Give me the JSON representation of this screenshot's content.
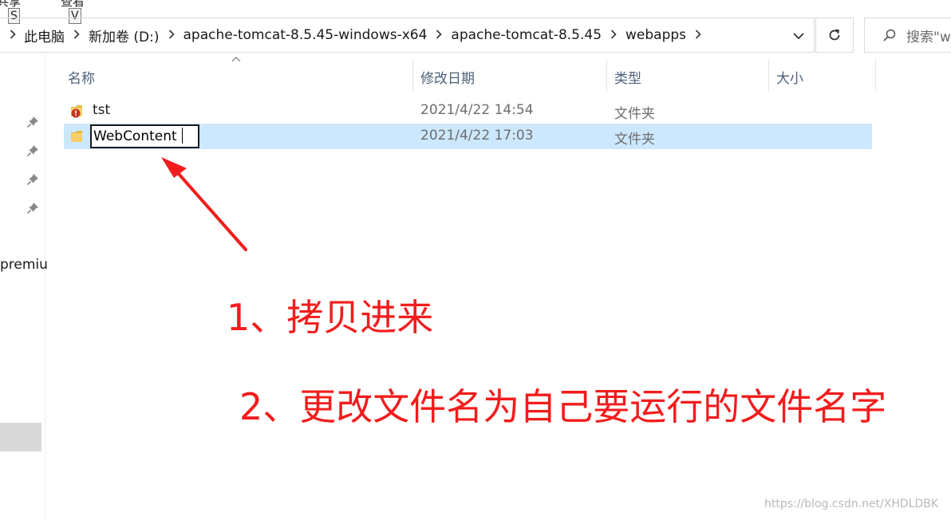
{
  "ribbon": {
    "tab1_label": "共享",
    "tab2_label": "查看",
    "keytip1": "S",
    "keytip2": "V"
  },
  "address_bar": {
    "breadcrumbs": [
      "此电脑",
      "新加卷 (D:)",
      "apache-tomcat-8.5.45-windows-x64",
      "apache-tomcat-8.5.45",
      "webapps"
    ]
  },
  "search": {
    "placeholder": "搜索\"w"
  },
  "nav_pane": {
    "partial_item": "premiu"
  },
  "columns": {
    "name": "名称",
    "date_modified": "修改日期",
    "type": "类型",
    "size": "大小"
  },
  "rows": [
    {
      "name": "tst",
      "date": "2021/4/22 14:54",
      "type": "文件夹",
      "icon": "folder-icon-error-overlay"
    },
    {
      "name": "WebContent",
      "date": "2021/4/22 17:03",
      "type": "文件夹",
      "icon": "folder-icon",
      "state": "renaming"
    }
  ],
  "annotations": {
    "step1": "1、拷贝进来",
    "step2": "2、更改文件名为自己要运行的文件名字",
    "color": "#f21c1c"
  },
  "watermark": "https://blog.csdn.net/XHDLDBK"
}
